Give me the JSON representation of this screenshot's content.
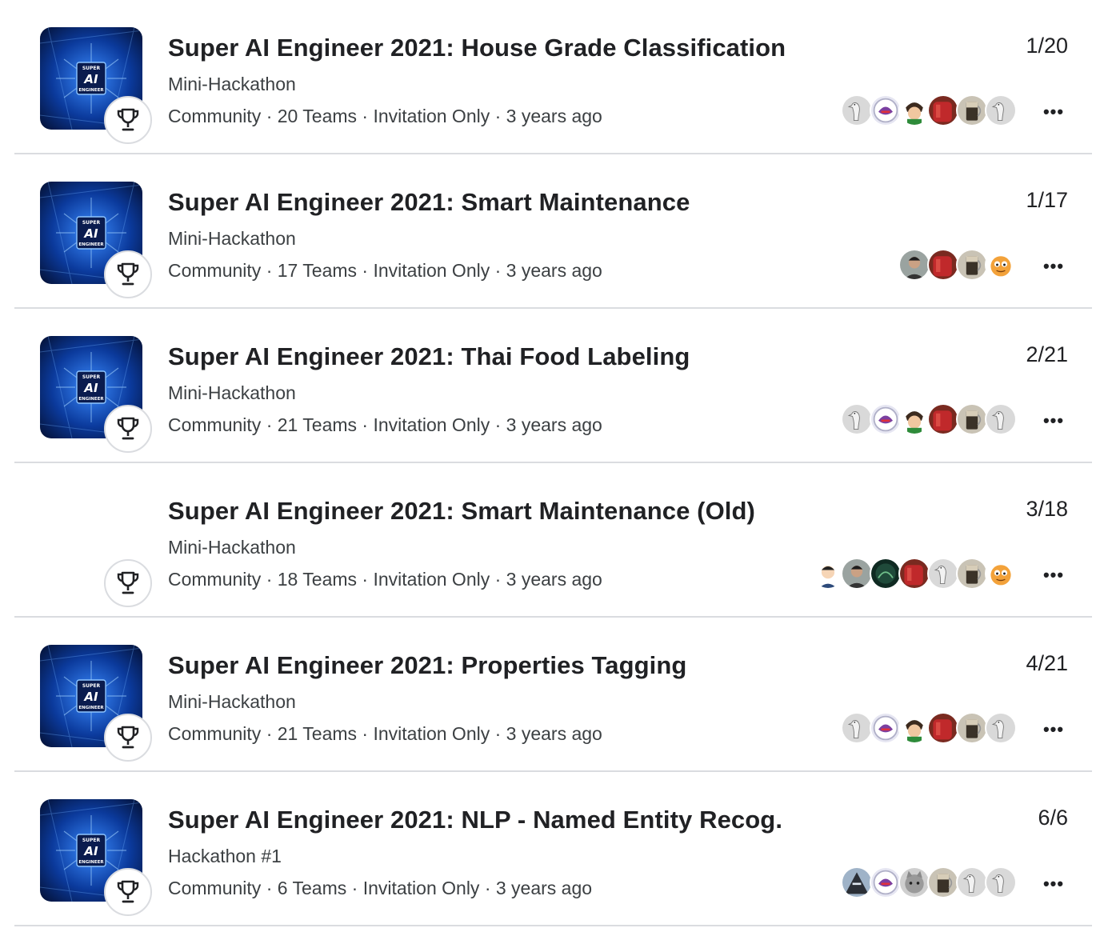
{
  "competitions": [
    {
      "title": "Super AI Engineer 2021: House Grade Classification",
      "subtitle": "Mini-Hackathon",
      "meta": "Community · 20 Teams · Invitation Only · 3 years ago",
      "rank": "1/20",
      "has_thumbnail": true,
      "avatars": [
        "goose",
        "anime-bird",
        "cartoon-boy",
        "red-pot",
        "glass-mug",
        "goose"
      ]
    },
    {
      "title": "Super AI Engineer 2021: Smart Maintenance",
      "subtitle": "Mini-Hackathon",
      "meta": "Community · 17 Teams · Invitation Only · 3 years ago",
      "rank": "1/17",
      "has_thumbnail": true,
      "avatars": [
        "person-photo",
        "red-pot",
        "glass-mug",
        "orange-cat"
      ]
    },
    {
      "title": "Super AI Engineer 2021: Thai Food Labeling",
      "subtitle": "Mini-Hackathon",
      "meta": "Community · 21 Teams · Invitation Only · 3 years ago",
      "rank": "2/21",
      "has_thumbnail": true,
      "avatars": [
        "goose",
        "anime-bird",
        "cartoon-boy",
        "red-pot",
        "glass-mug",
        "goose"
      ]
    },
    {
      "title": "Super AI Engineer 2021: Smart Maintenance (Old)",
      "subtitle": "Mini-Hackathon",
      "meta": "Community · 18 Teams · Invitation Only · 3 years ago",
      "rank": "3/18",
      "has_thumbnail": false,
      "avatars": [
        "cartoon-man",
        "person-photo",
        "dark-green",
        "red-pot",
        "goose",
        "glass-mug",
        "orange-cat"
      ]
    },
    {
      "title": "Super AI Engineer 2021: Properties Tagging",
      "subtitle": "Mini-Hackathon",
      "meta": "Community · 21 Teams · Invitation Only · 3 years ago",
      "rank": "4/21",
      "has_thumbnail": true,
      "avatars": [
        "goose",
        "anime-bird",
        "cartoon-boy",
        "red-pot",
        "glass-mug",
        "goose"
      ]
    },
    {
      "title": "Super AI Engineer 2021: NLP - Named Entity Recog.",
      "subtitle": "Hackathon #1",
      "meta": "Community · 6 Teams · Invitation Only · 3 years ago",
      "rank": "6/6",
      "has_thumbnail": true,
      "avatars": [
        "dark-figure",
        "anime-bird",
        "grey-kitten",
        "glass-mug",
        "goose",
        "goose"
      ]
    }
  ],
  "thumbnail_text": {
    "line1": "SUPER",
    "line2": "AI",
    "line3": "ENGINEER"
  },
  "more_label": "•••",
  "colors": {
    "divider": "#dadce0",
    "title": "#202124",
    "meta": "#3c4043",
    "thumb_bg": "#0a2a6b",
    "thumb_glow": "#2f7bff"
  },
  "icons": {
    "trophy": "trophy-icon",
    "more": "more-options-icon"
  }
}
